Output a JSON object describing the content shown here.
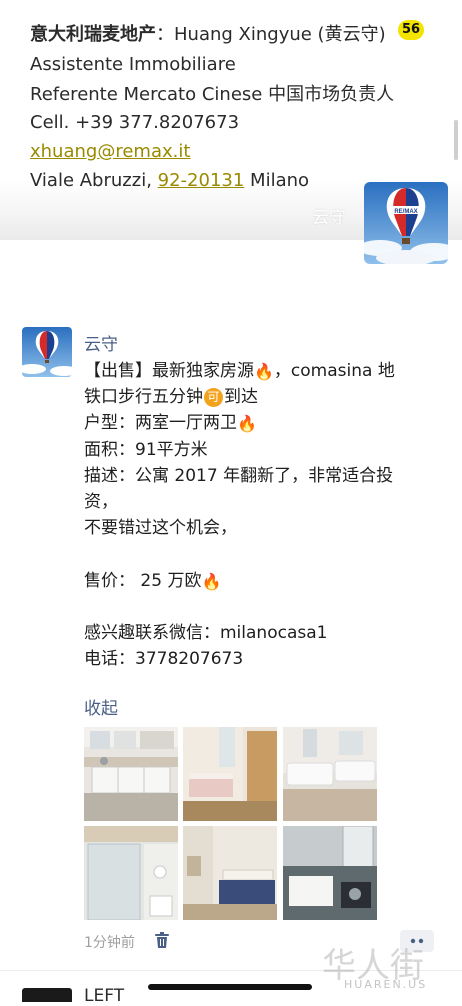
{
  "signature": {
    "line1_company": "意大利瑞麦地产",
    "line1_rest": "：Huang Xingyue (黄云守)",
    "line2": "Assistente Immobiliare",
    "line3": "Referente Mercato Cinese 中国市场负责人",
    "line4": "Cell. +39 377.8207673",
    "line5_email": "xhuang@remax.it",
    "line6_pre": "Viale Abruzzi, ",
    "line6_link": "92-20131",
    "line6_post": " Milano"
  },
  "badge_count": "56",
  "overlay_name": "云守",
  "post": {
    "author": "云守",
    "lines": [
      {
        "t1": "【出售】最新独家房源",
        "fire": "🔥",
        "t2": "，comasina 地"
      },
      {
        "t1": "铁口步行五分钟",
        "ke": "可",
        "t2": "到达"
      },
      {
        "t1": "户型：两室一厅两卫",
        "fire": "🔥",
        "t2": ""
      },
      {
        "t1": "面积：91平方米"
      },
      {
        "t1": "描述：公寓 2017 年翻新了，非常适合投"
      },
      {
        "t1": "资，"
      },
      {
        "t1": "不要错过这个机会，"
      },
      {
        "t1": ""
      },
      {
        "t1": "售价： 25 万欧",
        "fire": "🔥",
        "t2": ""
      },
      {
        "t1": ""
      },
      {
        "t1": "感兴趣联系微信：milanocasa1"
      },
      {
        "t1": "电话：3778207673"
      }
    ],
    "collapse_label": "收起",
    "time": "1分钟前",
    "photos": [
      "kitchen",
      "bedroom",
      "living-room",
      "shower",
      "bedroom-2",
      "bathroom"
    ]
  },
  "next_post": {
    "author": "LEFT"
  },
  "watermark": {
    "cn": "华人街",
    "en": "HUAREN.US"
  },
  "colors": {
    "link_name": "#4a5f86",
    "email": "#9a8a00",
    "badge": "#f2e400"
  }
}
